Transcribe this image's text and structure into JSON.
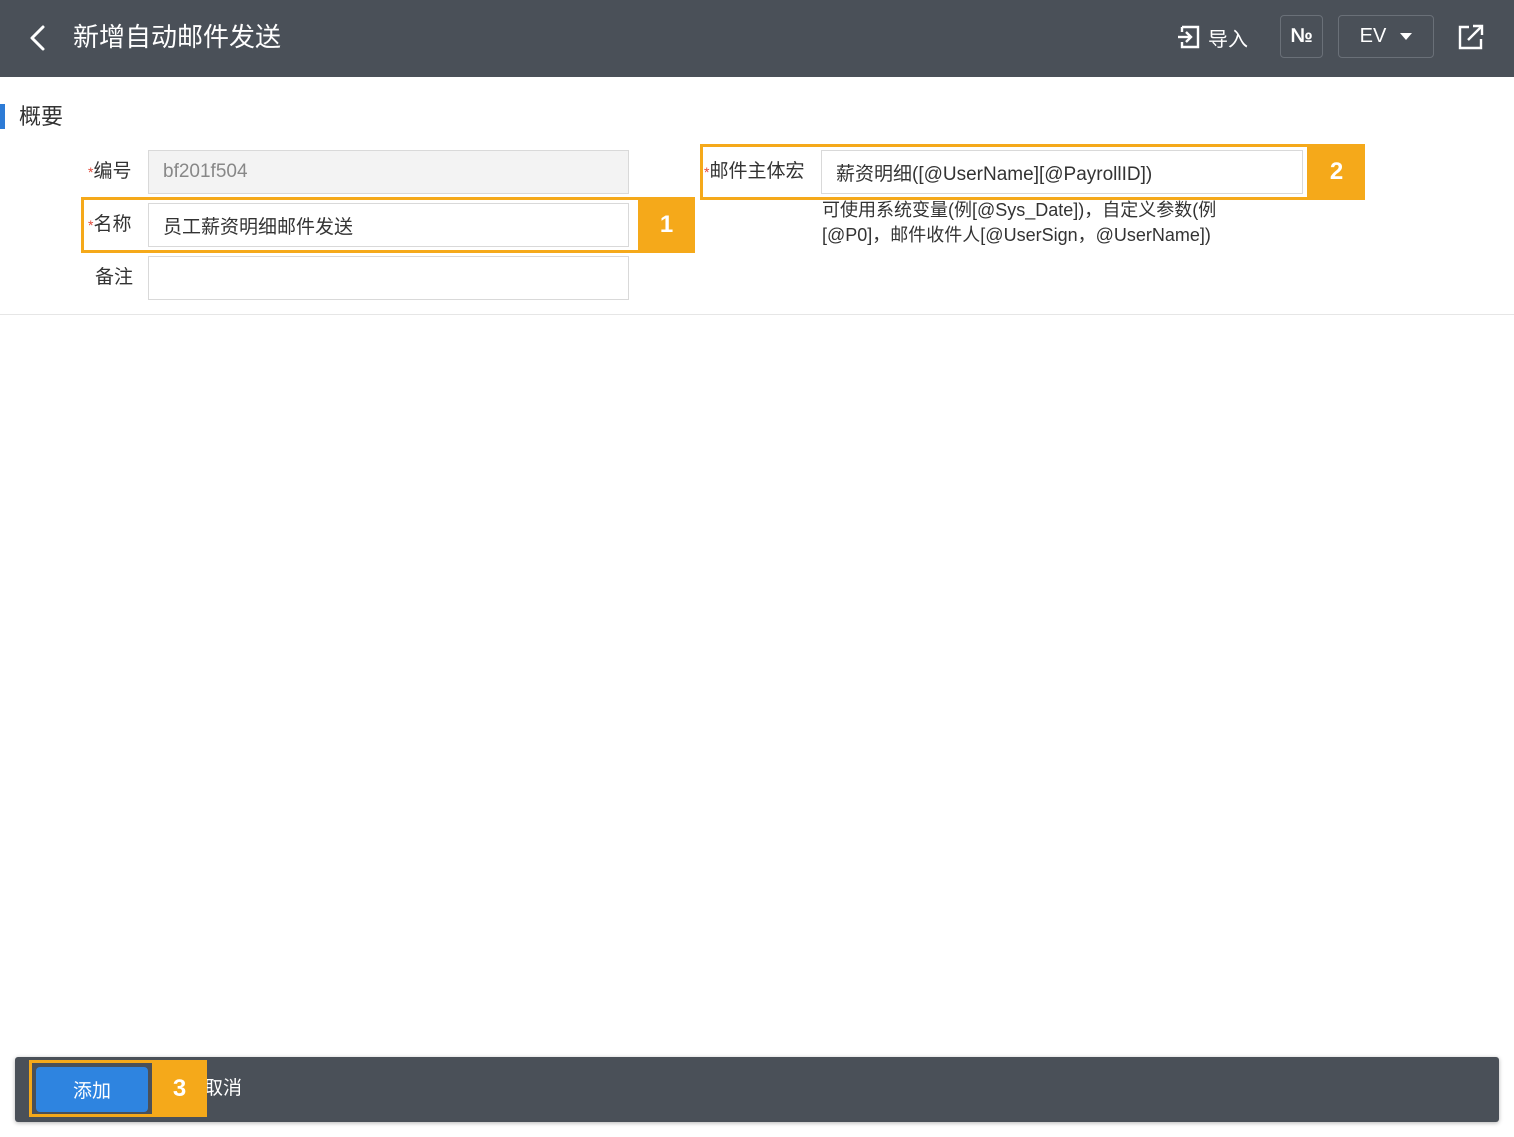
{
  "header": {
    "title": "新增自动邮件发送",
    "import_label": "导入",
    "number_label": "№",
    "language_label": "EV",
    "icons": {
      "back": "chevron-left-icon",
      "import": "import-icon",
      "share": "share-external-icon",
      "lang_caret": "caret-down-icon"
    }
  },
  "section": {
    "title": "概要"
  },
  "form": {
    "code": {
      "label": "编号",
      "required": "*",
      "value": "bf201f504"
    },
    "name": {
      "label": "名称",
      "required": "*",
      "value": "员工薪资明细邮件发送"
    },
    "remark": {
      "label": "备注",
      "value": ""
    },
    "macro": {
      "label": "邮件主体宏",
      "required": "*",
      "value": "薪资明细([@UserName][@PayrollID])",
      "hint": "可使用系统变量(例[@Sys_Date])，自定义参数(例[@P0]，邮件收件人[@UserSign，@UserName])"
    }
  },
  "callouts": {
    "one": "1",
    "two": "2",
    "three": "3"
  },
  "footer": {
    "add_label": "添加",
    "cancel_label": "取消"
  },
  "colors": {
    "header_bg": "#4a5058",
    "accent": "#2d7bd6",
    "callout": "#f5a91a",
    "primary_button": "#2e84e0",
    "required": "#e24a3b"
  }
}
